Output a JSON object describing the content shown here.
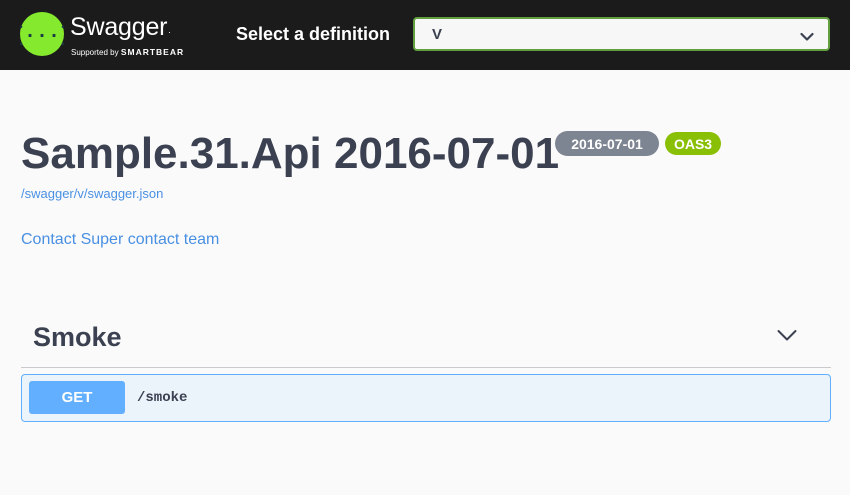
{
  "header": {
    "logo_name": "Swagger",
    "logo_tm": ".",
    "logo_supported": "Supported by",
    "logo_brand": "SMARTBEAR",
    "select_label": "Select a definition",
    "selected_definition": "V"
  },
  "info": {
    "title": "Sample.31.Api 2016-07-01",
    "version_badge": "2016-07-01",
    "oas_badge": "OAS3",
    "spec_url": "/swagger/v/swagger.json",
    "contact": "Contact Super contact team"
  },
  "tags": [
    {
      "name": "Smoke",
      "operations": [
        {
          "method": "GET",
          "path": "/smoke"
        }
      ]
    }
  ],
  "colors": {
    "topbar": "#1b1b1b",
    "logo_green": "#85ea2d",
    "select_border": "#62a03f",
    "get_method": "#61affe",
    "get_bg": "#ebf3fb",
    "link": "#4990e2",
    "version_badge": "#7d8492",
    "oas_badge": "#89bf04"
  },
  "icons": {
    "logo": "swagger-logo-icon",
    "select_chevron": "chevron-down-icon",
    "tag_chevron": "chevron-down-icon"
  }
}
